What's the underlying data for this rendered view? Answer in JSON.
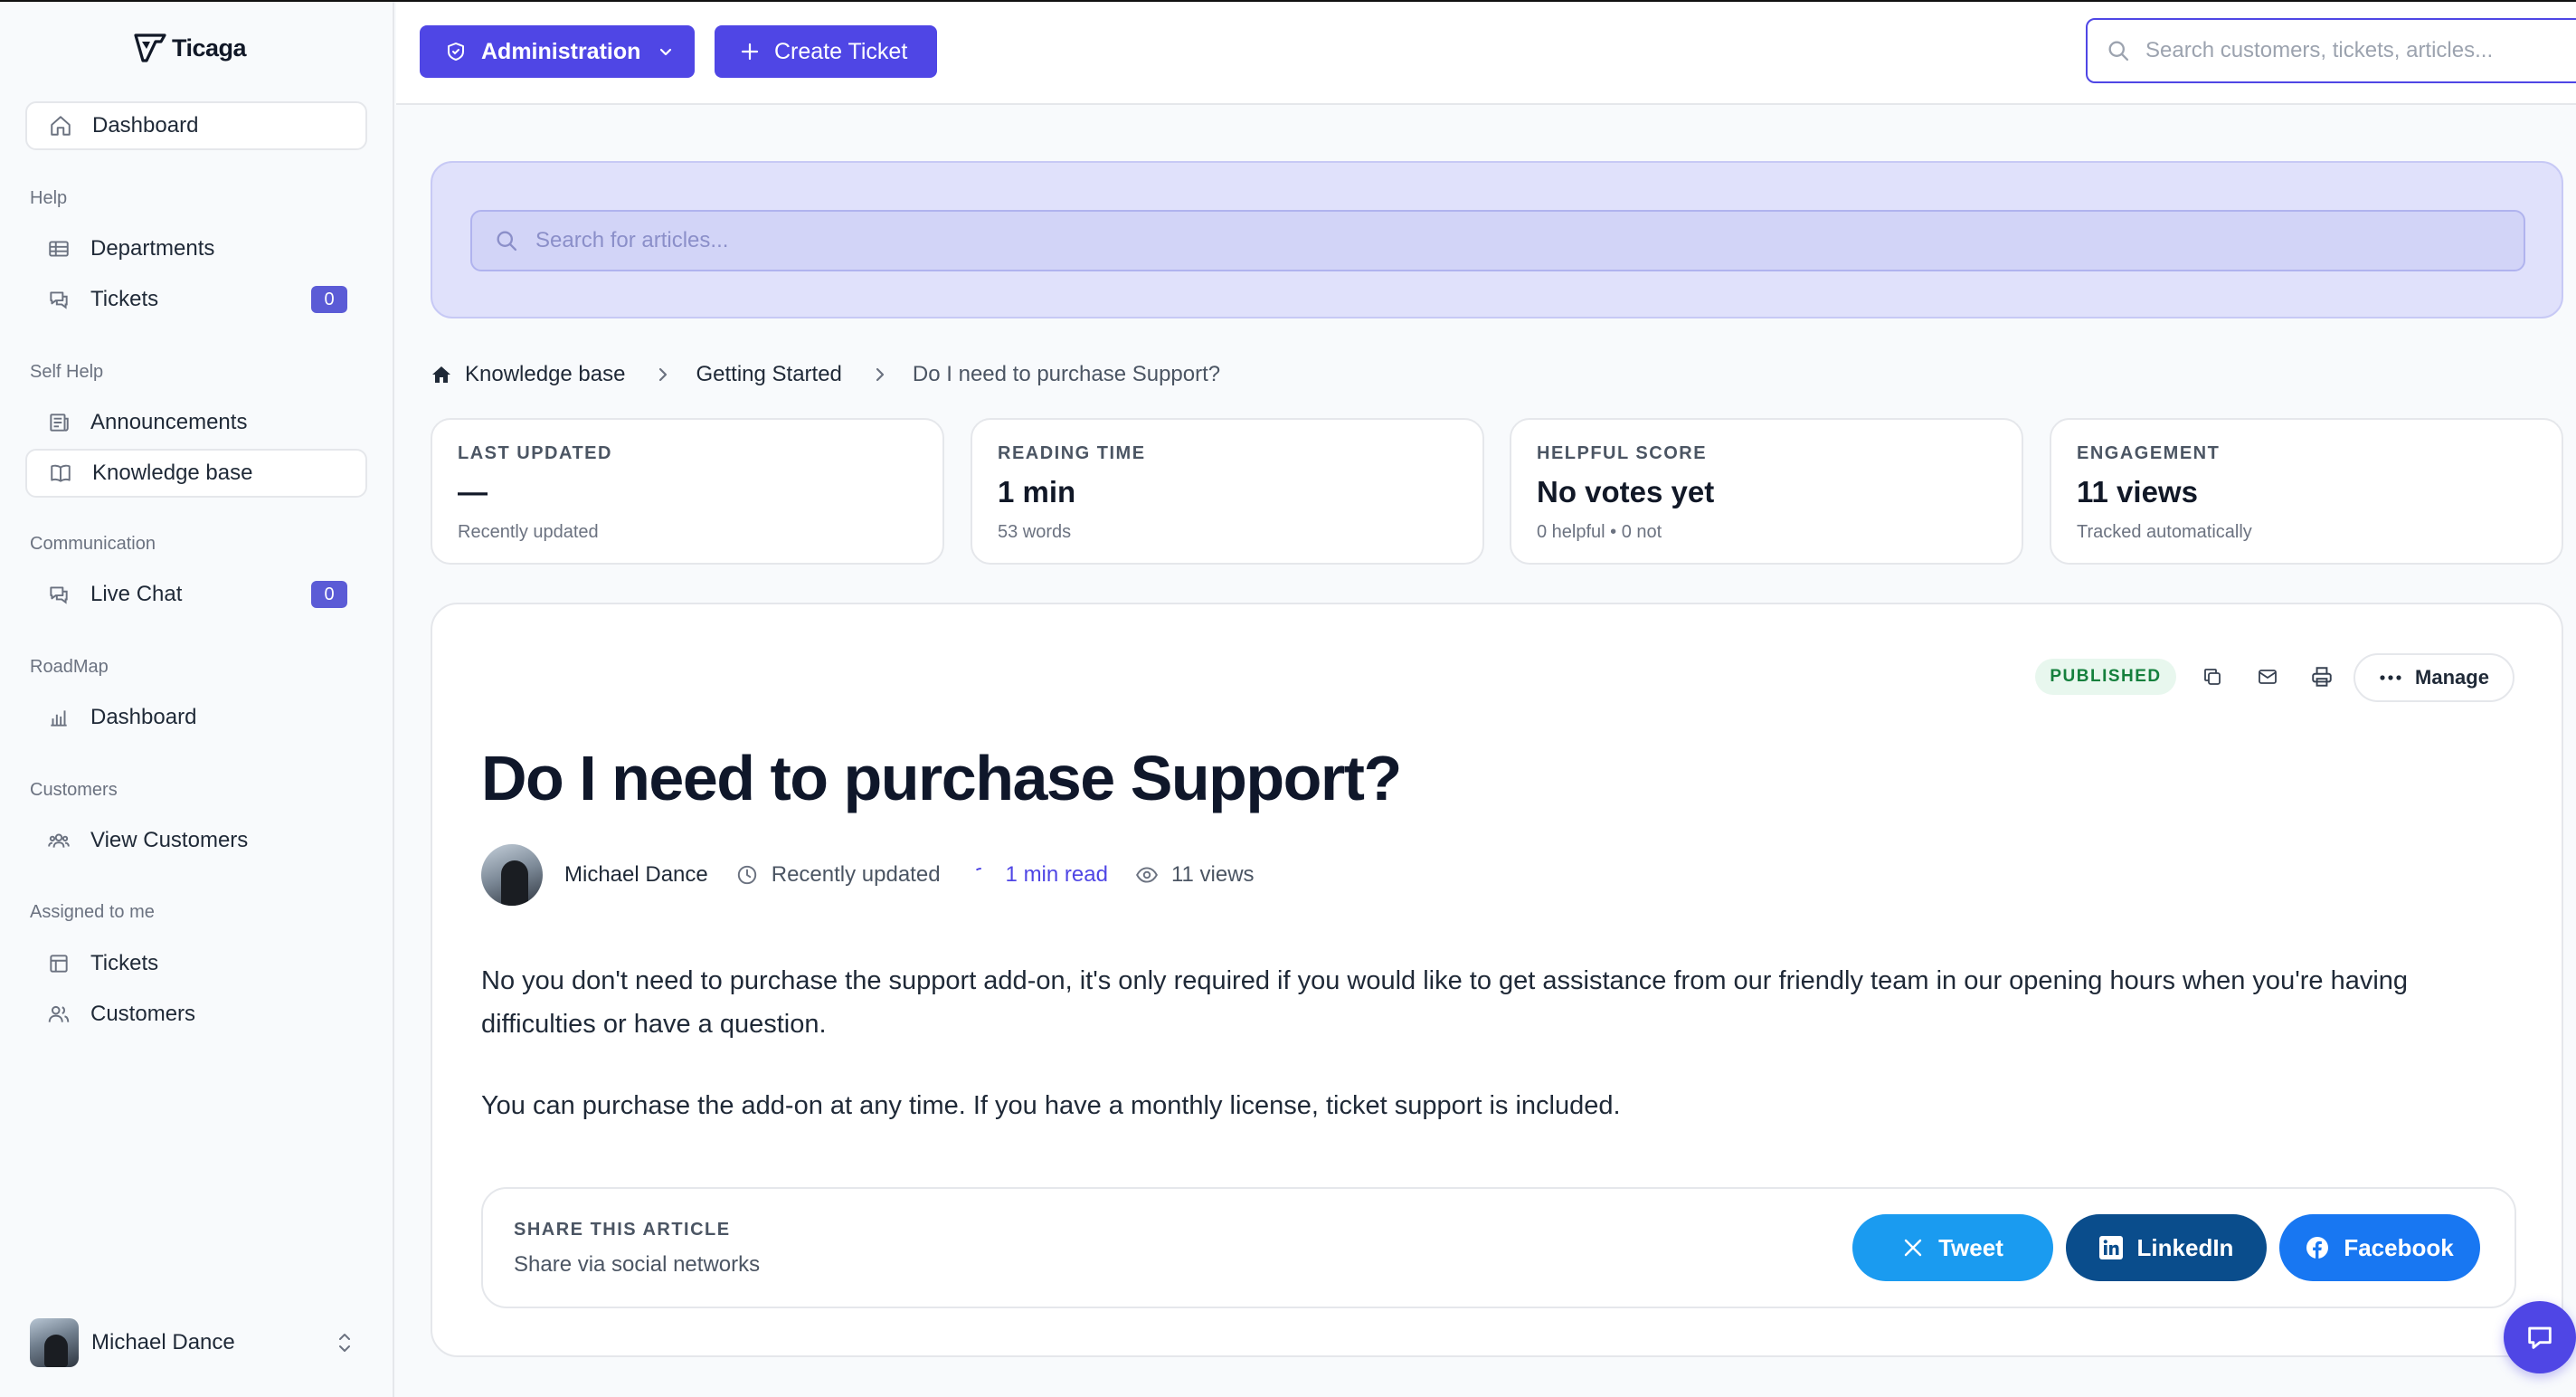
{
  "app": {
    "name": "Ticaga"
  },
  "sidebar": {
    "dashboard": "Dashboard",
    "sections": {
      "help": "Help",
      "self_help": "Self Help",
      "communication": "Communication",
      "roadmap": "RoadMap",
      "customers": "Customers",
      "assigned": "Assigned to me"
    },
    "items": {
      "departments": "Departments",
      "tickets": "Tickets",
      "tickets_count": "0",
      "announcements": "Announcements",
      "knowledge_base": "Knowledge base",
      "live_chat": "Live Chat",
      "live_chat_count": "0",
      "roadmap_dashboard": "Dashboard",
      "view_customers": "View Customers",
      "assigned_tickets": "Tickets",
      "assigned_customers": "Customers"
    },
    "user": {
      "name": "Michael Dance"
    }
  },
  "topbar": {
    "admin_label": "Administration",
    "create_label": "Create Ticket",
    "search_placeholder": "Search customers, tickets, articles..."
  },
  "hero": {
    "search_placeholder": "Search for articles..."
  },
  "breadcrumb": {
    "root": "Knowledge base",
    "category": "Getting Started",
    "current": "Do I need to purchase Support?"
  },
  "stats": [
    {
      "label": "LAST UPDATED",
      "value": "—",
      "sub": "Recently updated"
    },
    {
      "label": "READING TIME",
      "value": "1 min",
      "sub": "53 words"
    },
    {
      "label": "HELPFUL SCORE",
      "value": "No votes yet",
      "sub": "0 helpful • 0 not"
    },
    {
      "label": "ENGAGEMENT",
      "value": "11 views",
      "sub": "Tracked automatically"
    }
  ],
  "article": {
    "status": "PUBLISHED",
    "manage_label": "Manage",
    "title": "Do I need to purchase Support?",
    "author": "Michael Dance",
    "updated": "Recently updated",
    "read_time": "1 min read",
    "views": "11 views",
    "paragraphs": [
      "No you don't need to purchase the support add-on, it's only required if you would like to get assistance from our friendly team in our opening hours when you're having difficulties or have a question.",
      "You can purchase the add-on at any time. If you have a monthly license, ticket support is included."
    ]
  },
  "share": {
    "title": "SHARE THIS ARTICLE",
    "subtitle": "Share via social networks",
    "tweet": "Tweet",
    "linkedin": "LinkedIn",
    "facebook": "Facebook"
  },
  "colors": {
    "accent": "#4f46e5",
    "badge": "#5b5bd6",
    "published": "#15803d",
    "twitter": "#1a9bf0",
    "linkedin": "#0a4d8c",
    "facebook": "#1877f2"
  }
}
